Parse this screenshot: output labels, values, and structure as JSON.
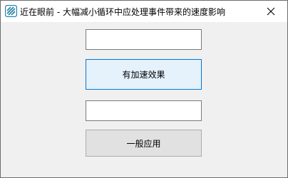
{
  "window": {
    "title": "近在眼前 - 大幅减小循环中应处理事件带来的速度影响",
    "icon": "app-stripes-icon",
    "close_icon": "close-icon"
  },
  "form": {
    "input_1": {
      "value": "",
      "placeholder": ""
    },
    "button_accent": {
      "label": "有加速效果"
    },
    "input_2": {
      "value": "",
      "placeholder": ""
    },
    "button_plain": {
      "label": "一般应用"
    }
  },
  "colors": {
    "accent_border": "#0078d7",
    "accent_fill": "#e5f1fb",
    "window_bg": "#f0f0f0"
  }
}
